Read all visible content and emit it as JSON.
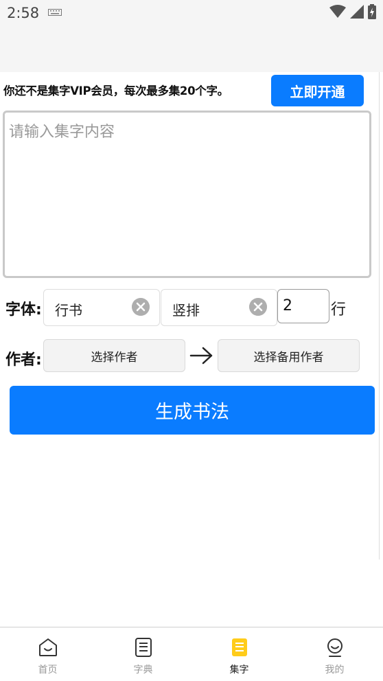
{
  "status_bar": {
    "time": "2:58"
  },
  "vip": {
    "notice": "你还不是集字VIP会员，每次最多集20个字。",
    "button_label": "立即开通"
  },
  "content_input": {
    "placeholder": "请输入集字内容"
  },
  "font_row": {
    "label": "字体:",
    "font_primary": "行书",
    "font_secondary": "竖排",
    "rows_value": "2",
    "rows_suffix": "行"
  },
  "author_row": {
    "label": "作者:",
    "select_author": "选择作者",
    "select_backup_author": "选择备用作者"
  },
  "generate_button": "生成书法",
  "tabs": [
    {
      "label": "首页",
      "icon": "home-icon"
    },
    {
      "label": "字典",
      "icon": "dictionary-icon"
    },
    {
      "label": "集字",
      "icon": "collect-icon"
    },
    {
      "label": "我的",
      "icon": "profile-icon"
    }
  ],
  "colors": {
    "accent": "#0a7cff",
    "active_tab_icon": "#ffcc1a",
    "inactive_tab": "#9a9a9a"
  }
}
